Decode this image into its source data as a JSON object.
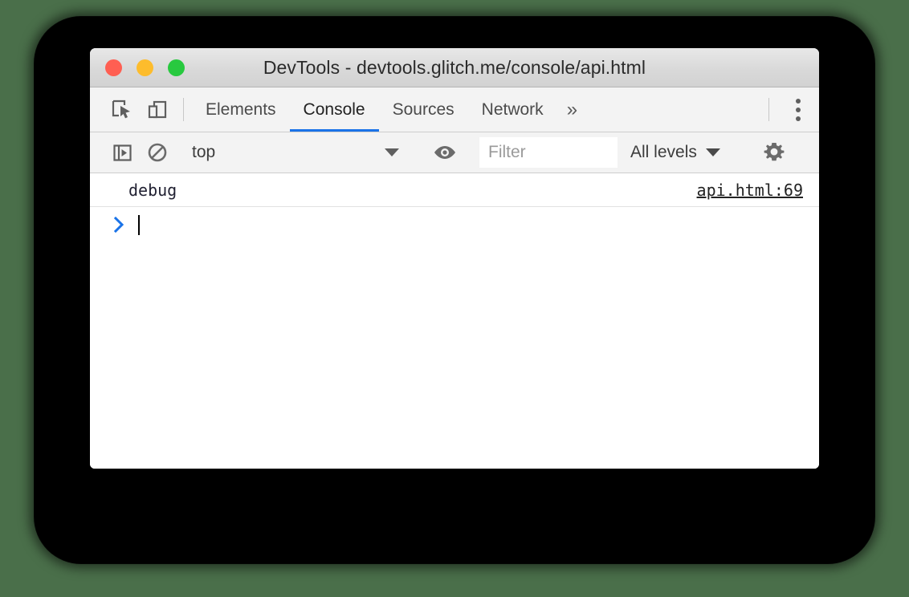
{
  "window": {
    "title": "DevTools - devtools.glitch.me/console/api.html",
    "traffic_lights": [
      {
        "name": "close",
        "color": "#ff5f52"
      },
      {
        "name": "minimize",
        "color": "#fdbc2c"
      },
      {
        "name": "zoom",
        "color": "#28c93f"
      }
    ]
  },
  "tabbar": {
    "inspect_icon": "inspect-element-icon",
    "device_icon": "device-toolbar-icon",
    "tabs": [
      {
        "label": "Elements",
        "active": false
      },
      {
        "label": "Console",
        "active": true
      },
      {
        "label": "Sources",
        "active": false
      },
      {
        "label": "Network",
        "active": false
      }
    ],
    "more_tabs_label": "»",
    "menu_icon": "kebab-menu-icon",
    "active_tab_color": "#1a73e8"
  },
  "filterbar": {
    "sidebar_toggle_icon": "console-sidebar-icon",
    "clear_console_icon": "clear-console-icon",
    "context": {
      "selected": "top",
      "options": [
        "top"
      ]
    },
    "eye_icon": "live-expression-eye-icon",
    "filter": {
      "value": "",
      "placeholder": "Filter"
    },
    "levels": {
      "selected": "All levels",
      "options": [
        "All levels"
      ]
    },
    "settings_icon": "settings-gear-icon"
  },
  "console": {
    "messages": [
      {
        "text": "debug",
        "source": "api.html:69"
      }
    ],
    "prompt": {
      "caret_icon": "prompt-chevron-icon",
      "caret_color": "#1a73e8",
      "input_value": ""
    }
  }
}
